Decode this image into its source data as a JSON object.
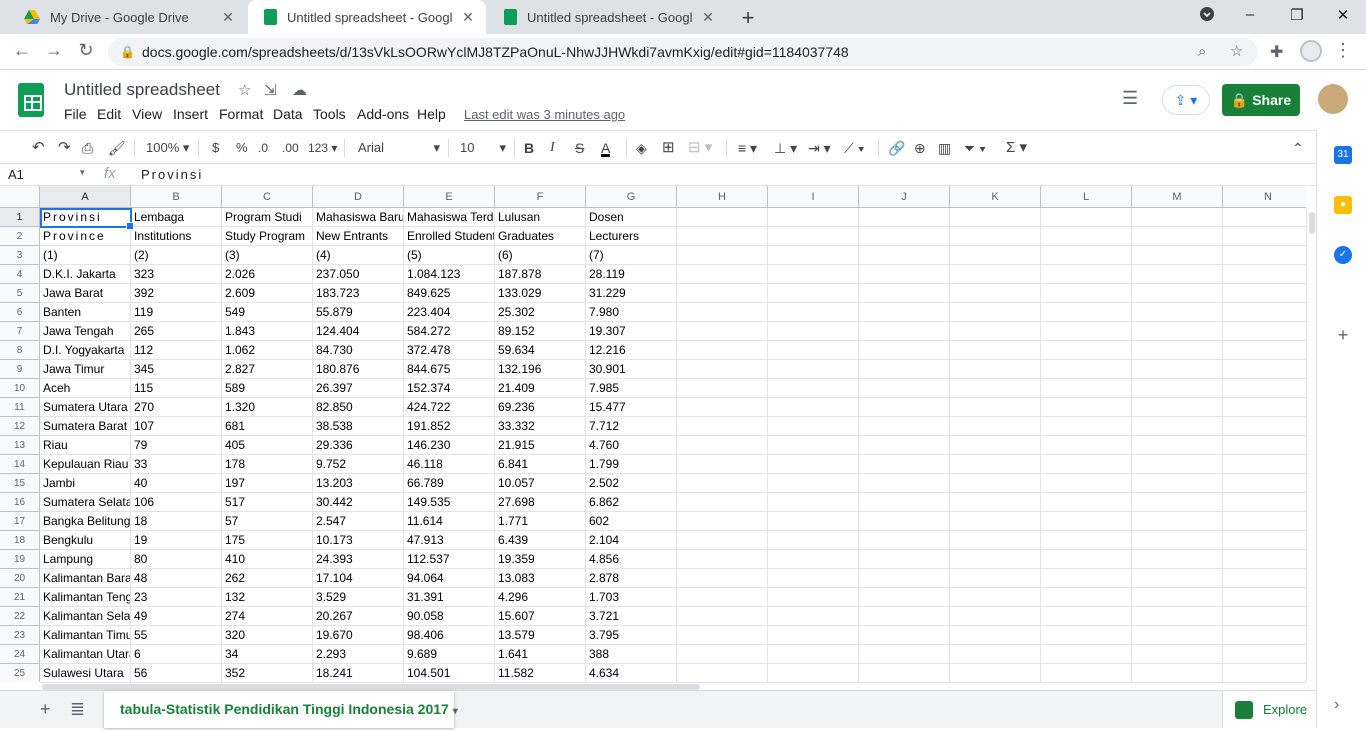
{
  "browser": {
    "tabs": [
      {
        "title": "My Drive - Google Drive",
        "close": "✕"
      },
      {
        "title": "Untitled spreadsheet - Google Sh",
        "close": "✕"
      },
      {
        "title": "Untitled spreadsheet - Google Sh",
        "close": "✕"
      }
    ],
    "new_tab": "+",
    "url": "docs.google.com/spreadsheets/d/13sVkLsOORwYclMJ8TZPaOnuL-NhwJJHWkdi7avmKxig/edit#gid=1184037748"
  },
  "doc": {
    "title": "Untitled spreadsheet",
    "menu": [
      "File",
      "Edit",
      "View",
      "Insert",
      "Format",
      "Data",
      "Tools",
      "Add-ons",
      "Help"
    ],
    "last_edit": "Last edit was 3 minutes ago",
    "share_label": "Share"
  },
  "toolbar": {
    "zoom": "100%",
    "currency": "$",
    "percent": "%",
    "dec_decrease": ".0",
    "dec_increase": ".00",
    "more_formats": "123",
    "font": "Arial",
    "font_size": "10",
    "bold": "B",
    "italic": "I",
    "strike": "S",
    "text_color": "A",
    "functions": "Σ"
  },
  "formula_bar": {
    "name_box": "A1",
    "fx": "fx",
    "content": "Provinsi"
  },
  "columns": [
    "A",
    "B",
    "C",
    "D",
    "E",
    "F",
    "G",
    "H",
    "I",
    "J",
    "K",
    "L",
    "M",
    "N"
  ],
  "rows": [
    [
      "Provinsi",
      "Lembaga",
      "Program Studi",
      "Mahasiswa Baru",
      "Mahasiswa Terdaftar",
      "Lulusan",
      "Dosen"
    ],
    [
      "Province",
      "Institutions",
      "Study Program",
      "New Entrants",
      "Enrolled Students",
      "Graduates",
      "Lecturers"
    ],
    [
      "(1)",
      "(2)",
      "(3)",
      "(4)",
      "(5)",
      "(6)",
      "(7)"
    ],
    [
      "D.K.I. Jakarta",
      "323",
      "2.026",
      "237.050",
      "1.084.123",
      "187.878",
      "28.119"
    ],
    [
      "Jawa Barat",
      "392",
      "2.609",
      "183.723",
      "849.625",
      "133.029",
      "31.229"
    ],
    [
      "Banten",
      "119",
      "549",
      "55.879",
      "223.404",
      "25.302",
      "7.980"
    ],
    [
      "Jawa Tengah",
      "265",
      "1.843",
      "124.404",
      "584.272",
      "89.152",
      "19.307"
    ],
    [
      "D.I. Yogyakarta",
      "112",
      "1.062",
      "84.730",
      "372.478",
      "59.634",
      "12.216"
    ],
    [
      "Jawa Timur",
      "345",
      "2.827",
      "180.876",
      "844.675",
      "132.196",
      "30.901"
    ],
    [
      "Aceh",
      "115",
      "589",
      "26.397",
      "152.374",
      "21.409",
      "7.985"
    ],
    [
      "Sumatera Utara",
      "270",
      "1.320",
      "82.850",
      "424.722",
      "69.236",
      "15.477"
    ],
    [
      "Sumatera Barat",
      "107",
      "681",
      "38.538",
      "191.852",
      "33.332",
      "7.712"
    ],
    [
      "Riau",
      "79",
      "405",
      "29.336",
      "146.230",
      "21.915",
      "4.760"
    ],
    [
      "Kepulauan Riau",
      "33",
      "178",
      "9.752",
      "46.118",
      "6.841",
      "1.799"
    ],
    [
      "Jambi",
      "40",
      "197",
      "13.203",
      "66.789",
      "10.057",
      "2.502"
    ],
    [
      "Sumatera Selatan",
      "106",
      "517",
      "30.442",
      "149.535",
      "27.698",
      "6.862"
    ],
    [
      "Bangka Belitung",
      "18",
      "57",
      "2.547",
      "11.614",
      "1.771",
      "602"
    ],
    [
      "Bengkulu",
      "19",
      "175",
      "10.173",
      "47.913",
      "6.439",
      "2.104"
    ],
    [
      "Lampung",
      "80",
      "410",
      "24.393",
      "112.537",
      "19.359",
      "4.856"
    ],
    [
      "Kalimantan Barat",
      "48",
      "262",
      "17.104",
      "94.064",
      "13.083",
      "2.878"
    ],
    [
      "Kalimantan Tengah",
      "23",
      "132",
      "3.529",
      "31.391",
      "4.296",
      "1.703"
    ],
    [
      "Kalimantan Selatan",
      "49",
      "274",
      "20.267",
      "90.058",
      "15.607",
      "3.721"
    ],
    [
      "Kalimantan Timur",
      "55",
      "320",
      "19.670",
      "98.406",
      "13.579",
      "3.795"
    ],
    [
      "Kalimantan Utara",
      "6",
      "34",
      "2.293",
      "9.689",
      "1.641",
      "388"
    ],
    [
      "Sulawesi Utara",
      "56",
      "352",
      "18.241",
      "104.501",
      "11.582",
      "4.634"
    ]
  ],
  "sheet": {
    "tab_name": "tabula-Statistik Pendidikan Tinggi Indonesia 2017",
    "explore": "Explore"
  },
  "colors": {
    "accent_green": "#188038",
    "selection_blue": "#1a73e8"
  }
}
